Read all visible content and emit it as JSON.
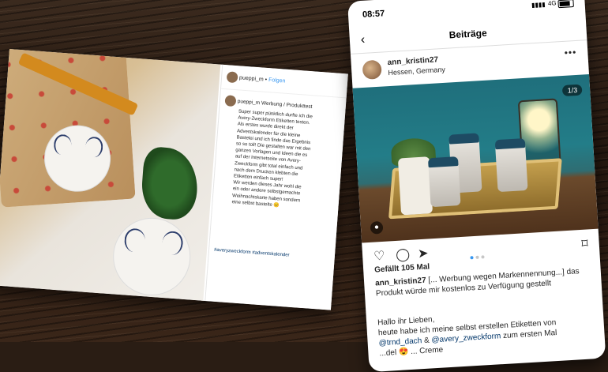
{
  "desktop_post": {
    "username": "pueppi_m",
    "follow_label": "Folgen",
    "caption_head": "pueppi_m Werbung / Produkttest",
    "caption_lines": [
      "Super super pünktlich durfte ich die",
      "Avery-Zweckform Etiketten testen.",
      "Als erstes wurde direkt der",
      "Adventskalender für die kleine",
      "Bastelei und ich finde das Ergebnis",
      "so so toll! Die gestalten war mit den",
      "ganzen Vorlagen und Ideen die es",
      "auf der Internetseite von Avery-",
      "Zweckform gibt total einfach und",
      "nach dem Drucken klebten die",
      "Etiketten einfach super!",
      "Wir werden dieses Jahr wohl die",
      "ein oder andere selbstgemachte",
      "Weihnachtskarte haben sondern",
      "eine selbst bastelte 😊"
    ],
    "hashtags": "#averyzweckform #adventskalender"
  },
  "phone": {
    "status": {
      "time": "08:57",
      "network": "4G",
      "signal": "▮▮▮▮"
    },
    "nav": {
      "back_icon": "‹",
      "title": "Beiträge"
    },
    "post": {
      "username": "ann_kristin27",
      "location": "Hessen, Germany",
      "more_icon": "•••",
      "photo_counter": "1/3",
      "likes": "Gefällt 105 Mal",
      "caption_user": "ann_kristin27",
      "caption_text": "[... Werbung wegen Markennennung...] das Produkt würde mir kostenlos zu Verfügung gestellt",
      "caption_more_1": "Hallo ihr Lieben,",
      "caption_more_2": "heute habe ich meine selbst erstellen Etiketten von",
      "mention_1": "@trnd_dach",
      "amp": "&",
      "mention_2": "@avery_zweckform",
      "caption_more_3": "zum ersten Mal",
      "caption_more_4": "...del 😍 ... Creme"
    },
    "icons": {
      "like": "heart-icon",
      "comment": "comment-icon",
      "share": "share-icon",
      "save": "bookmark-icon"
    },
    "carousel": {
      "pages": 3,
      "active": 1
    }
  }
}
